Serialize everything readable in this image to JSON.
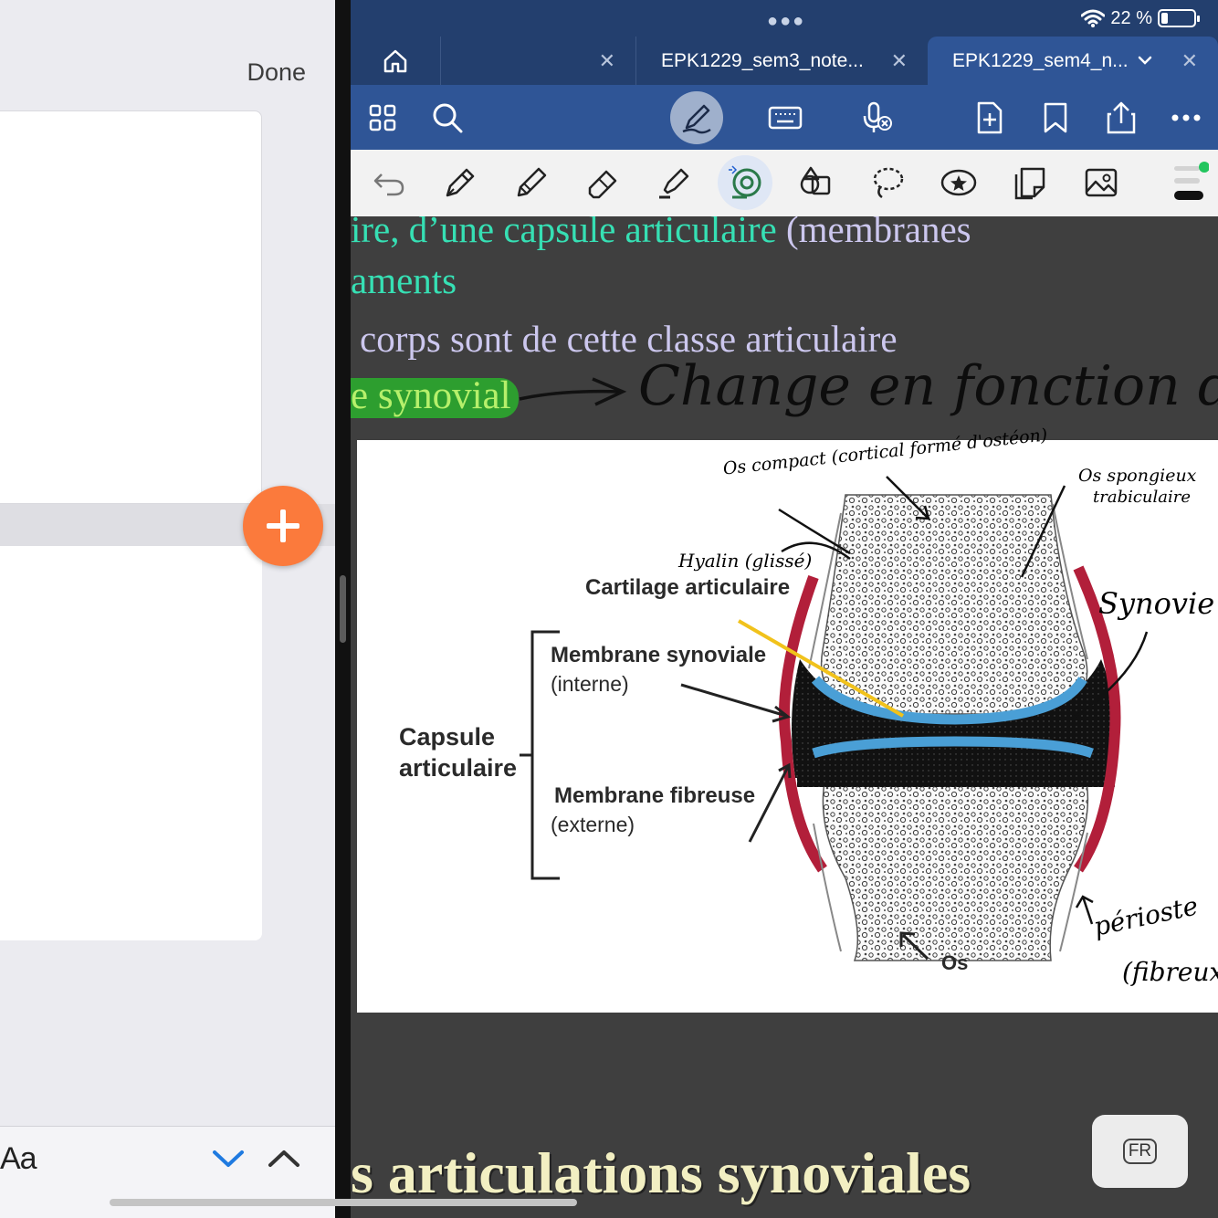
{
  "left_panel": {
    "done_label": "Done",
    "find_bar": {
      "format_label": "Aa"
    }
  },
  "status_bar": {
    "battery_text": "22 %",
    "battery_percent": 22
  },
  "tabs": [
    {
      "label": ""
    },
    {
      "label": "EPK1229_sem3_note..."
    },
    {
      "label": "EPK1229_sem4_n..."
    }
  ],
  "document": {
    "line1_main": "ire, d’une capsule articulaire ",
    "line1_paren": "(membranes",
    "line2": "aments",
    "line3": "corps sont de cette classe articulaire",
    "line4_highlight": "e synovial",
    "annotation_change": "Change en fonction des",
    "figure": {
      "cartilage_label": "Cartilage articulaire",
      "membrane_synoviale_label": "Membrane synoviale",
      "membrane_synoviale_sub": "(interne)",
      "capsule_line1": "Capsule",
      "capsule_line2": "articulaire",
      "membrane_fibreuse_label": "Membrane fibreuse",
      "membrane_fibreuse_sub": "(externe)",
      "os_label": "Os",
      "note_os_compact": "Os compact (cortical formé d'ostéon)",
      "note_os_spongieux_1": "Os spongieux",
      "note_os_spongieux_2": "trabiculaire",
      "note_hyalin": "Hyalin (glissé)",
      "note_synovie": "Synovie",
      "note_periost_1": "périoste",
      "note_periost_2": "(fibreux)"
    },
    "section_title": "s articulations synoviales"
  },
  "language_button": "FR",
  "colors": {
    "titlebar": "#233f6e",
    "toolbar": "#2f5596",
    "accent_orange": "#fb7a3c",
    "doc_background": "#3f3f3f",
    "text_teal": "#36e0b4",
    "highlight_green": "#2d9e2f"
  },
  "icons": {
    "toolbar1": [
      "grid-icon",
      "search-icon",
      "pen-mode-icon",
      "keyboard-icon",
      "voice-icon",
      "add-page-icon",
      "bookmark-icon",
      "share-icon",
      "more-icon"
    ],
    "toolbar2": [
      "undo-icon",
      "fountain-pen-icon",
      "pencil-icon",
      "eraser-icon",
      "highlighter-icon",
      "tape-tool-icon",
      "shapes-icon",
      "lasso-icon",
      "sticker-icon",
      "sticky-note-icon",
      "image-icon",
      "stroke-width-icon"
    ]
  }
}
